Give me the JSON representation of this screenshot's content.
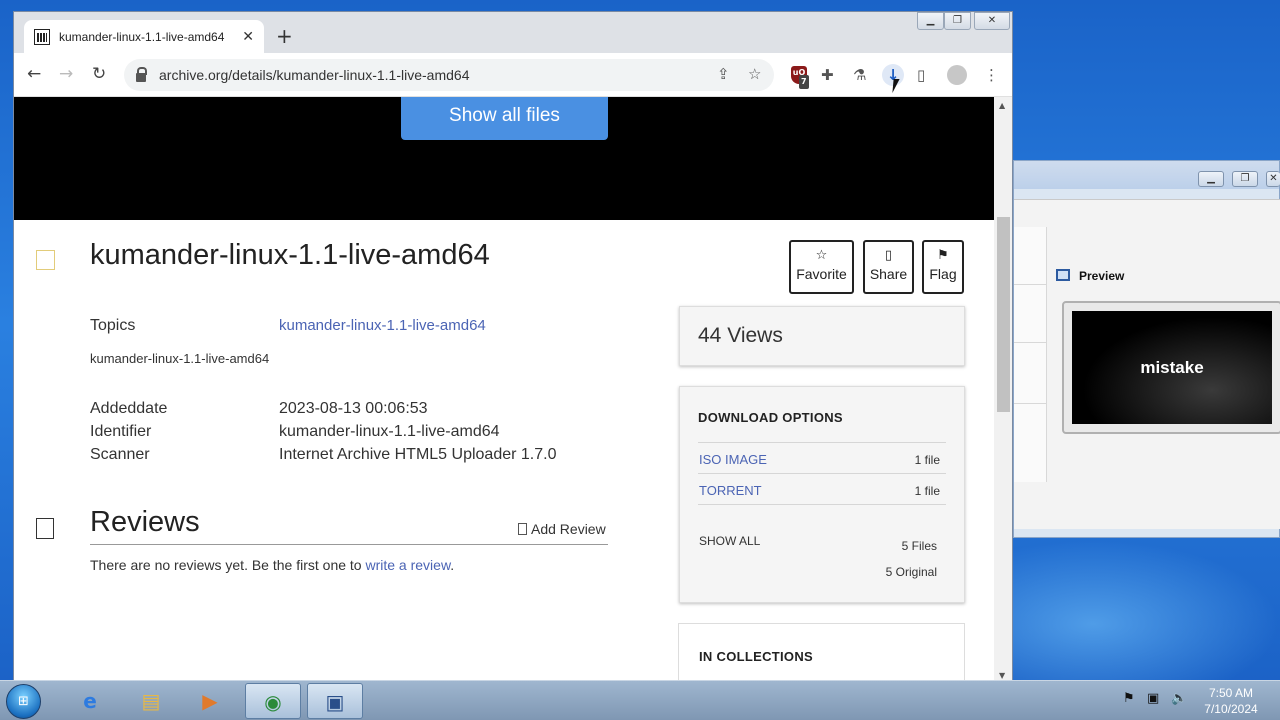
{
  "browser": {
    "tab_title": "kumander-linux-1.1-live-amd64",
    "tab_close": "✕",
    "new_tab": "+",
    "url": "archive.org/details/kumander-linux-1.1-live-amd64",
    "extension_badge_count": "7"
  },
  "page": {
    "show_all_files": "Show all files",
    "title": "kumander-linux-1.1-live-amd64",
    "actions": {
      "favorite": "Favorite",
      "share": "Share",
      "flag": "Flag"
    },
    "metadata": {
      "topics_label": "Topics",
      "topics_value": "kumander-linux-1.1-live-amd64",
      "description": "kumander-linux-1.1-live-amd64",
      "addeddate_label": "Addeddate",
      "addeddate_value": "2023-08-13 00:06:53",
      "identifier_label": "Identifier",
      "identifier_value": "kumander-linux-1.1-live-amd64",
      "scanner_label": "Scanner",
      "scanner_value": "Internet Archive HTML5 Uploader 1.7.0"
    },
    "reviews": {
      "heading": "Reviews",
      "add_review": "Add Review",
      "empty_text": "There are no reviews yet. Be the first one to ",
      "write_link": "write a review",
      "empty_suffix": "."
    },
    "views": "44 Views",
    "download_options": {
      "heading": "DOWNLOAD OPTIONS",
      "items": [
        {
          "label": "ISO IMAGE",
          "count": "1 file"
        },
        {
          "label": "TORRENT",
          "count": "1 file"
        }
      ],
      "show_all": "SHOW ALL",
      "files_count": "5 Files",
      "original_count": "5 Original"
    },
    "collections_heading": "IN COLLECTIONS"
  },
  "background_window": {
    "preview_label": "Preview",
    "preview_text": "mistake"
  },
  "taskbar": {
    "time": "7:50 AM",
    "date": "7/10/2024"
  },
  "colors": {
    "link": "#4b64b4",
    "show_all_button": "#4a90e2",
    "hero": "#000000"
  }
}
